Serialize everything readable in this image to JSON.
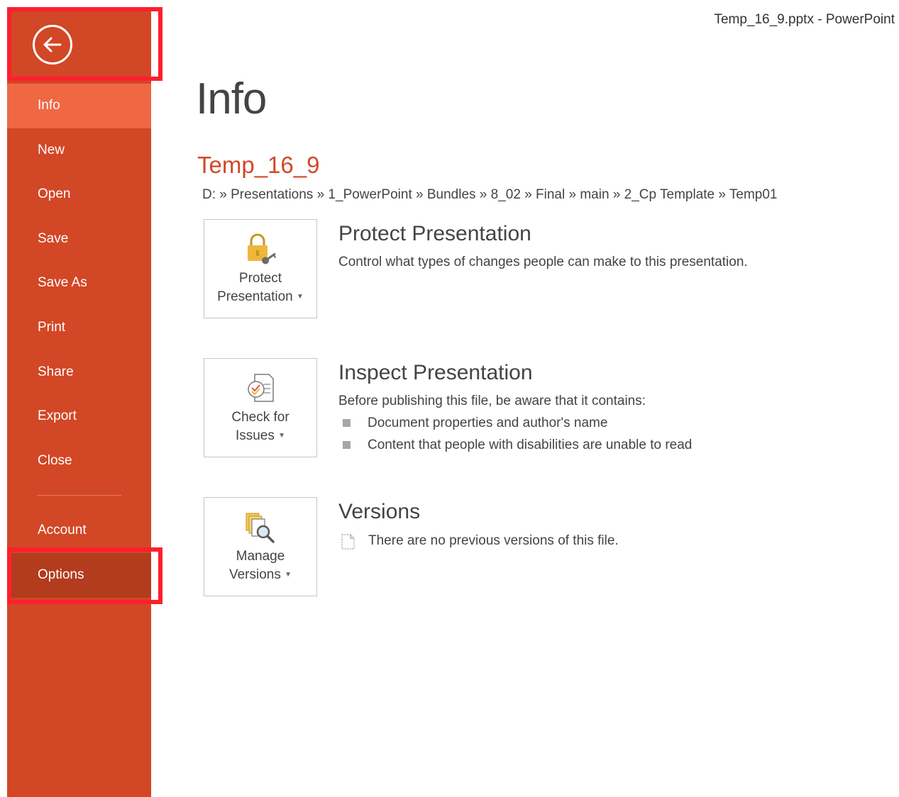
{
  "window": {
    "title": "Temp_16_9.pptx - PowerPoint"
  },
  "sidebar": {
    "back_icon": "back-arrow-icon",
    "items": [
      {
        "label": "Info"
      },
      {
        "label": "New"
      },
      {
        "label": "Open"
      },
      {
        "label": "Save"
      },
      {
        "label": "Save As"
      },
      {
        "label": "Print"
      },
      {
        "label": "Share"
      },
      {
        "label": "Export"
      },
      {
        "label": "Close"
      },
      {
        "label": "Account"
      },
      {
        "label": "Options"
      }
    ],
    "active": "Info",
    "colors": {
      "background": "#d24726",
      "active": "#f06743",
      "options": "#b33b1e",
      "highlight": "#ff1f2d"
    }
  },
  "main": {
    "title": "Info",
    "document_name": "Temp_16_9",
    "path": "D: » Presentations » 1_PowerPoint » Bundles » 8_02 » Final » main » 2_Cp Template » Temp01",
    "sections": [
      {
        "button_label_1": "Protect",
        "button_label_2": "Presentation",
        "icon": "lock-key-icon",
        "title": "Protect Presentation",
        "description": "Control what types of changes people can make to this presentation."
      },
      {
        "button_label_1": "Check for",
        "button_label_2": "Issues",
        "icon": "inspect-document-icon",
        "title": "Inspect Presentation",
        "description": "Before publishing this file, be aware that it contains:",
        "bullets": [
          "Document properties and author's name",
          "Content that people with disabilities are unable to read"
        ]
      },
      {
        "button_label_1": "Manage",
        "button_label_2": "Versions",
        "icon": "manage-versions-icon",
        "title": "Versions",
        "description": "There are no previous versions of this file."
      }
    ]
  }
}
